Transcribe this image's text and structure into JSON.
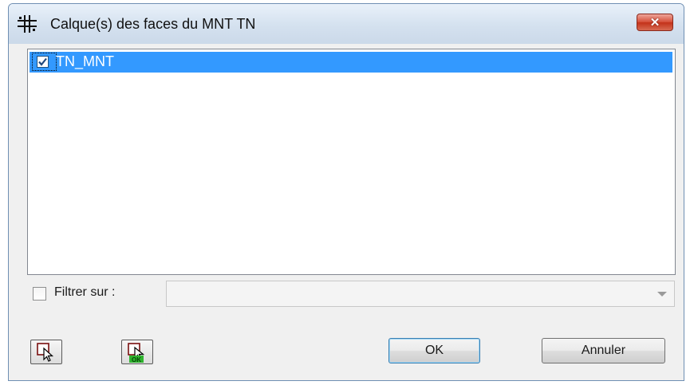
{
  "window": {
    "title": "Calque(s) des faces du MNT TN",
    "close_glyph": "✕",
    "icon": "grid-cross-icon"
  },
  "layer_list": {
    "items": [
      {
        "label": "TN_MNT",
        "checked": true,
        "selected": true
      }
    ]
  },
  "filter": {
    "checked": false,
    "label": "Filtrer sur :",
    "value": ""
  },
  "toolbar": {
    "select_icon": "select-pointer-icon",
    "select_ok_icon": "select-pointer-ok-icon",
    "ok_badge": "OK"
  },
  "buttons": {
    "ok_label": "OK",
    "cancel_label": "Annuler"
  },
  "colors": {
    "selection": "#3399ff",
    "close_button": "#c33219",
    "ok_badge_green": "#2fb42f"
  }
}
